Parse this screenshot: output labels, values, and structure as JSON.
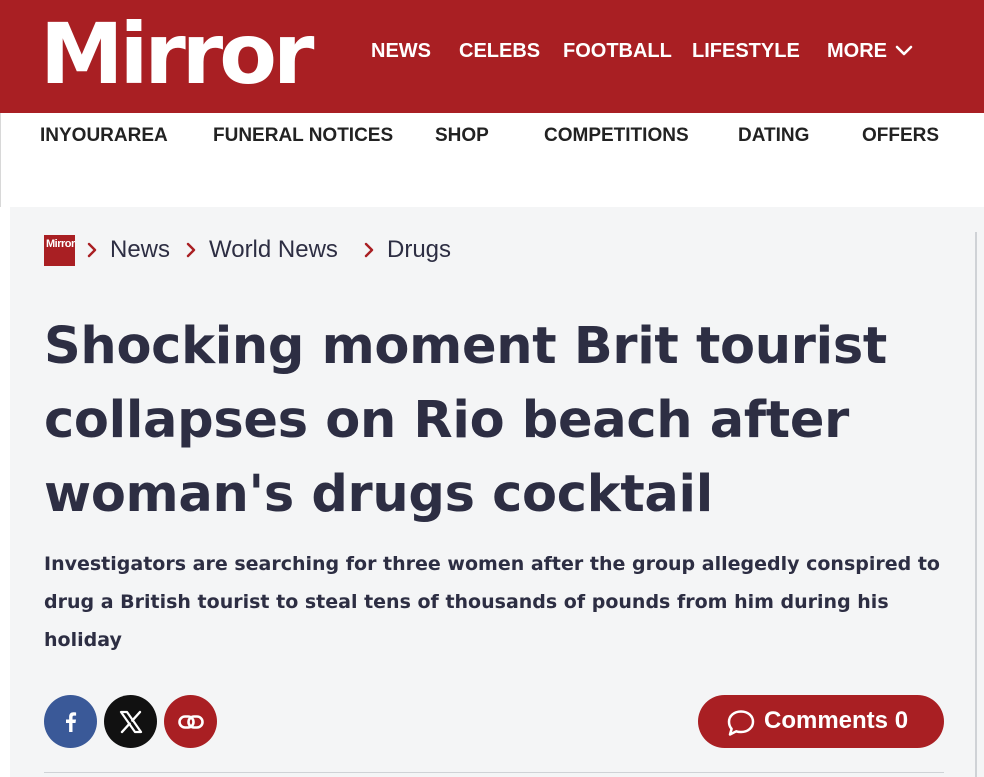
{
  "header": {
    "logo": "Mirror",
    "nav": [
      "NEWS",
      "CELEBS",
      "FOOTBALL",
      "LIFESTYLE",
      "MORE"
    ],
    "more_icon": "chevron-down-icon",
    "brand_color": "#a91f23"
  },
  "subnav": [
    "INYOURAREA",
    "FUNERAL NOTICES",
    "SHOP",
    "COMPETITIONS",
    "DATING",
    "OFFERS"
  ],
  "breadcrumb": {
    "logo_text": "Mirror",
    "items": [
      "News",
      "World News",
      "Drugs"
    ]
  },
  "article": {
    "headline": "Shocking moment Brit tourist collapses on Rio beach after woman's drugs cocktail",
    "standfirst": "Investigators are searching for three women after the group allegedly conspired to drug a British tourist to steal tens of thousands of pounds from him during his holiday"
  },
  "share": {
    "buttons": [
      {
        "icon": "facebook-icon",
        "color": "#3a5998"
      },
      {
        "icon": "x-icon",
        "color": "#111111"
      },
      {
        "icon": "link-icon",
        "color": "#a91f23"
      }
    ]
  },
  "comments": {
    "label": "Comments 0",
    "icon": "speech-bubble-icon"
  }
}
